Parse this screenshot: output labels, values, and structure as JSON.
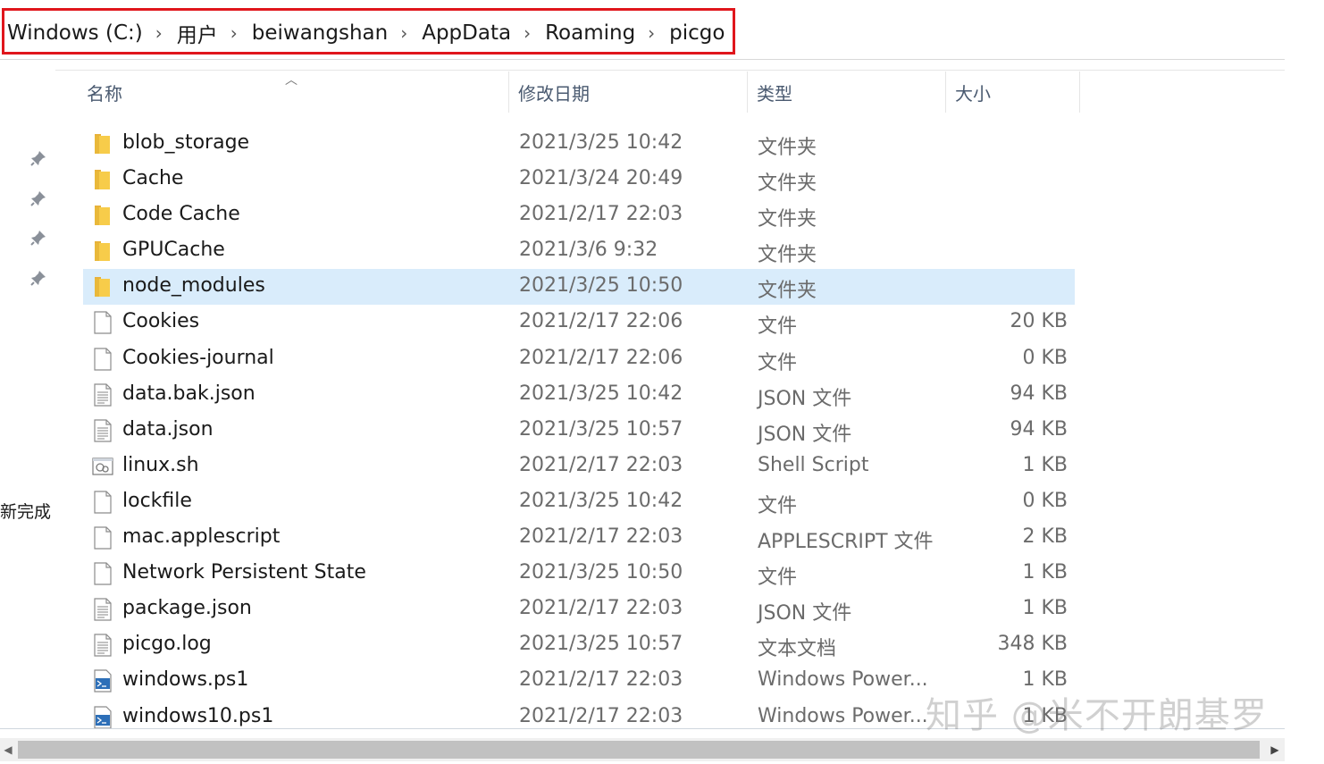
{
  "breadcrumb": {
    "items": [
      "Windows (C:)",
      "用户",
      "beiwangshan",
      "AppData",
      "Roaming",
      "picgo"
    ],
    "separator": "›",
    "highlight_color": "#e0161c"
  },
  "left_nav": {
    "pins": [
      "pin-icon",
      "pin-icon",
      "pin-icon",
      "pin-icon"
    ],
    "partial_text": "新完成"
  },
  "columns": {
    "name": "名称",
    "date": "修改日期",
    "type": "类型",
    "size": "大小"
  },
  "files": [
    {
      "name": "blob_storage",
      "date": "2021/3/25 10:42",
      "type": "文件夹",
      "size": "",
      "icon": "folder-icon"
    },
    {
      "name": "Cache",
      "date": "2021/3/24 20:49",
      "type": "文件夹",
      "size": "",
      "icon": "folder-icon"
    },
    {
      "name": "Code Cache",
      "date": "2021/2/17 22:03",
      "type": "文件夹",
      "size": "",
      "icon": "folder-icon"
    },
    {
      "name": "GPUCache",
      "date": "2021/3/6 9:32",
      "type": "文件夹",
      "size": "",
      "icon": "folder-icon"
    },
    {
      "name": "node_modules",
      "date": "2021/3/25 10:50",
      "type": "文件夹",
      "size": "",
      "icon": "folder-icon",
      "selected": true
    },
    {
      "name": "Cookies",
      "date": "2021/2/17 22:06",
      "type": "文件",
      "size": "20 KB",
      "icon": "file-icon"
    },
    {
      "name": "Cookies-journal",
      "date": "2021/2/17 22:06",
      "type": "文件",
      "size": "0 KB",
      "icon": "file-icon"
    },
    {
      "name": "data.bak.json",
      "date": "2021/3/25 10:42",
      "type": "JSON 文件",
      "size": "94 KB",
      "icon": "text-file-icon"
    },
    {
      "name": "data.json",
      "date": "2021/3/25 10:57",
      "type": "JSON 文件",
      "size": "94 KB",
      "icon": "text-file-icon"
    },
    {
      "name": "linux.sh",
      "date": "2021/2/17 22:03",
      "type": "Shell Script",
      "size": "1 KB",
      "icon": "script-icon"
    },
    {
      "name": "lockfile",
      "date": "2021/3/25 10:42",
      "type": "文件",
      "size": "0 KB",
      "icon": "file-icon"
    },
    {
      "name": "mac.applescript",
      "date": "2021/2/17 22:03",
      "type": "APPLESCRIPT 文件",
      "size": "2 KB",
      "icon": "file-icon"
    },
    {
      "name": "Network Persistent State",
      "date": "2021/3/25 10:50",
      "type": "文件",
      "size": "1 KB",
      "icon": "file-icon"
    },
    {
      "name": "package.json",
      "date": "2021/2/17 22:03",
      "type": "JSON 文件",
      "size": "1 KB",
      "icon": "text-file-icon"
    },
    {
      "name": "picgo.log",
      "date": "2021/3/25 10:57",
      "type": "文本文档",
      "size": "348 KB",
      "icon": "text-file-icon"
    },
    {
      "name": "windows.ps1",
      "date": "2021/2/17 22:03",
      "type": "Windows Power...",
      "size": "1 KB",
      "icon": "powershell-icon"
    },
    {
      "name": "windows10.ps1",
      "date": "2021/2/17 22:03",
      "type": "Windows Power...",
      "size": "1 KB",
      "icon": "powershell-icon"
    }
  ],
  "colors": {
    "selected_row": "#d9ecfb",
    "header_text": "#4a5a70",
    "meta_text": "#6b6b6b"
  },
  "watermark": "知乎 @米不开朗基罗"
}
